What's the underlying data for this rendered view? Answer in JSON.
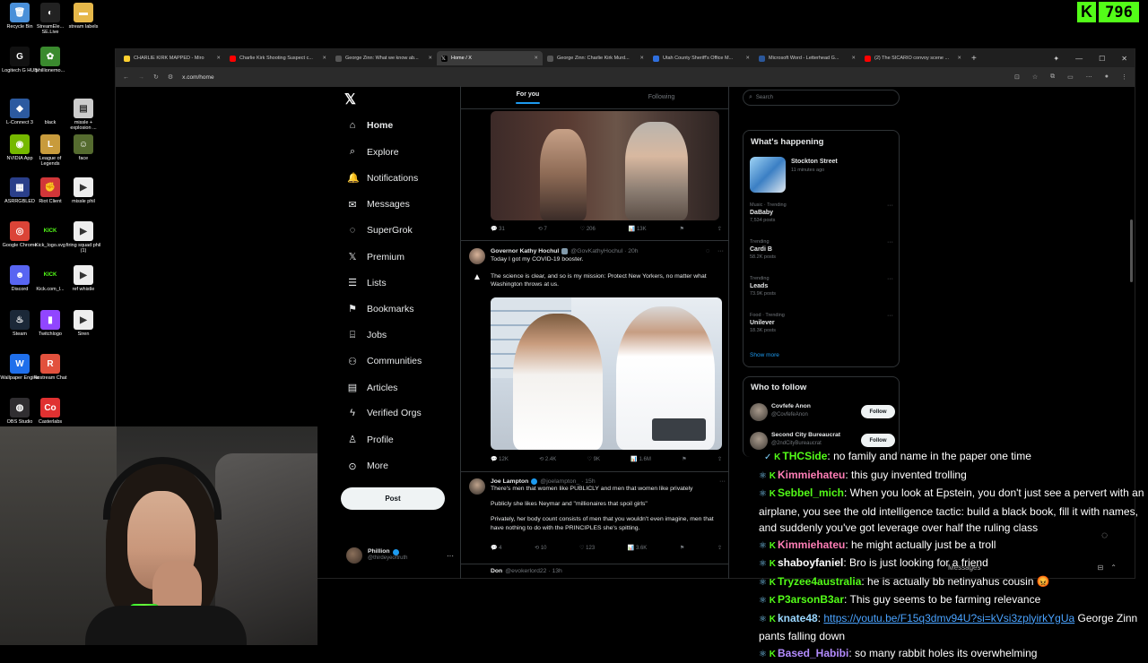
{
  "desktop": {
    "icons": [
      {
        "label": "Recycle Bin",
        "color": "#4a90d9",
        "glyph": "🗑"
      },
      {
        "label": "StreamEle... SE.Live",
        "color": "#222222",
        "glyph": "◐"
      },
      {
        "label": "stream labels",
        "color": "#e6b84a",
        "glyph": "▬"
      },
      {
        "label": "Logitech G HUB",
        "color": "#111111",
        "glyph": "G"
      },
      {
        "label": "phillionemo...",
        "color": "#3a8a2e",
        "glyph": "✿"
      },
      {
        "label": "L-Connect 3",
        "color": "#2c5aa0",
        "glyph": "◆"
      },
      {
        "label": "black",
        "color": "#000000",
        "glyph": ""
      },
      {
        "label": "missle + explosion ...",
        "color": "#cccccc",
        "glyph": "▤"
      },
      {
        "label": "NVIDIA App",
        "color": "#76b900",
        "glyph": "◉"
      },
      {
        "label": "League of Legends",
        "color": "#c89b3c",
        "glyph": "L"
      },
      {
        "label": "face",
        "color": "#556b2f",
        "glyph": "☺"
      },
      {
        "label": "ASRRGBLED",
        "color": "#2a3f8a",
        "glyph": "▦"
      },
      {
        "label": "Riot Client",
        "color": "#d13639",
        "glyph": "✊"
      },
      {
        "label": "missle phil",
        "color": "#eeeeee",
        "glyph": "▶"
      },
      {
        "label": "Google Chrome",
        "color": "#db4437",
        "glyph": "◎"
      },
      {
        "label": "Kick_logo.svg",
        "color": "#000000",
        "glyph": "KICK"
      },
      {
        "label": "firing squad phil (1)",
        "color": "#eeeeee",
        "glyph": "▶"
      },
      {
        "label": "Discord",
        "color": "#5865f2",
        "glyph": "☻"
      },
      {
        "label": "Kick.com_l...",
        "color": "#000000",
        "glyph": "KICK"
      },
      {
        "label": "ref whistle",
        "color": "#eeeeee",
        "glyph": "▶"
      },
      {
        "label": "Steam",
        "color": "#1b2838",
        "glyph": "♨"
      },
      {
        "label": "Twitchlogo",
        "color": "#9146ff",
        "glyph": "▮"
      },
      {
        "label": "Siren",
        "color": "#eeeeee",
        "glyph": "▶"
      },
      {
        "label": "Wallpaper Engine",
        "color": "#1f6feb",
        "glyph": "W"
      },
      {
        "label": "Restream Chat",
        "color": "#e2513d",
        "glyph": "R"
      },
      {
        "label": "OBS Studio",
        "color": "#302e31",
        "glyph": "◍"
      },
      {
        "label": "Casterlabs",
        "color": "#e03131",
        "glyph": "Co"
      }
    ]
  },
  "kick_counter": {
    "logo": "K",
    "count": "796",
    "color": "#53fc18"
  },
  "browser": {
    "tabs": [
      {
        "title": "CHARLIE KIRK MAPPED - Miro",
        "color": "#ffd02f"
      },
      {
        "title": "Charlie Kirk Shooting Suspect c...",
        "color": "#ff0000"
      },
      {
        "title": "George Zinn: What we know ab...",
        "color": "#555555"
      },
      {
        "title": "Home / X",
        "color": "#000000"
      },
      {
        "title": "George Zinn: Charlie Kirk Murd...",
        "color": "#555555"
      },
      {
        "title": "Utah County Sheriff's Office M...",
        "color": "#2f6fde"
      },
      {
        "title": "Microsoft Word - Letterhead G...",
        "color": "#2b579a"
      },
      {
        "title": "(2) The SICARIO convoy scene ...",
        "color": "#ff0000"
      }
    ],
    "url": "x.com/home"
  },
  "x": {
    "logo": "𝕏",
    "nav": [
      {
        "label": "Home",
        "icon": "home-icon",
        "glyph": "⌂"
      },
      {
        "label": "Explore",
        "icon": "search-icon",
        "glyph": "⌕"
      },
      {
        "label": "Notifications",
        "icon": "bell-icon",
        "glyph": "🔔"
      },
      {
        "label": "Messages",
        "icon": "envelope-icon",
        "glyph": "✉"
      },
      {
        "label": "SuperGrok",
        "icon": "grok-icon",
        "glyph": "◌"
      },
      {
        "label": "Premium",
        "icon": "x-premium-icon",
        "glyph": "𝕏"
      },
      {
        "label": "Lists",
        "icon": "list-icon",
        "glyph": "☰"
      },
      {
        "label": "Bookmarks",
        "icon": "bookmark-icon",
        "glyph": "⚑"
      },
      {
        "label": "Jobs",
        "icon": "briefcase-icon",
        "glyph": "⌸"
      },
      {
        "label": "Communities",
        "icon": "people-icon",
        "glyph": "⚇"
      },
      {
        "label": "Articles",
        "icon": "article-icon",
        "glyph": "▤"
      },
      {
        "label": "Verified Orgs",
        "icon": "lightning-icon",
        "glyph": "ϟ"
      },
      {
        "label": "Profile",
        "icon": "person-icon",
        "glyph": "♙"
      },
      {
        "label": "More",
        "icon": "more-circle-icon",
        "glyph": "⊙"
      }
    ],
    "post_label": "Post",
    "account": {
      "name": "Phillion",
      "handle": "@thirdeyeoftruth"
    },
    "feed_tabs": {
      "for_you": "For you",
      "following": "Following"
    },
    "tweet1_actions": {
      "replies": "31",
      "reposts": "7",
      "likes": "206",
      "views": "13K"
    },
    "tweet2": {
      "name": "Governor Kathy Hochul",
      "handle": "@GovKathyHochul · 20h",
      "line1": "Today I got my COVID-19 booster.",
      "line2": "The science is clear, and so is my mission: Protect New Yorkers, no matter what Washington throws at us.",
      "actions": {
        "replies": "12K",
        "reposts": "2.4K",
        "likes": "9K",
        "views": "1.6M"
      }
    },
    "tweet3": {
      "name": "Joe Lampton",
      "handle": "@joelampton_ · 15h",
      "line1": "There's men that women like PUBLICLY and men that women like privately",
      "line2": "Publicly she likes Neymar and \"millionaires that spoil girls\"",
      "line3": "Privately, her body count consists of men that you wouldn't even imagine, men that have nothing to do with the PRINCIPLES she's spitting.",
      "actions": {
        "replies": "4",
        "reposts": "10",
        "likes": "123",
        "views": "3.6K"
      }
    },
    "tweet4": {
      "name": "Don",
      "handle": "@evokerlord22 · 13h"
    },
    "search_placeholder": "Search",
    "whats_happening": {
      "title": "What's happening",
      "event": {
        "title": "Stockton Street",
        "time": "11 minutes ago"
      },
      "trends": [
        {
          "context": "Music · Trending",
          "name": "DaBaby",
          "posts": "7,534 posts"
        },
        {
          "context": "Trending",
          "name": "Cardi B",
          "posts": "58.2K posts"
        },
        {
          "context": "Trending",
          "name": "Leads",
          "posts": "73.9K posts"
        },
        {
          "context": "Food · Trending",
          "name": "Unilever",
          "posts": "18.3K posts"
        }
      ],
      "show_more": "Show more"
    },
    "who_to_follow": {
      "title": "Who to follow",
      "accounts": [
        {
          "name": "Covfefe Anon",
          "handle": "@CovfefeAnon",
          "button": "Follow"
        },
        {
          "name": "Second City Bureaucrat",
          "handle": "@2ndCityBureaucrat",
          "button": "Follow"
        }
      ]
    },
    "messages_label": "Messages"
  },
  "chat": [
    {
      "user": "THCSide",
      "color": "#53fc18",
      "msg": ": no family and name in the paper one time"
    },
    {
      "user": "Kimmiehateu",
      "color": "#ff7eb6",
      "msg": ": this guy invented trolling"
    },
    {
      "user": "Sebbel_mich",
      "color": "#53fc18",
      "msg": ": When you look at Epstein, you don't just see a pervert with an airplane, you see the old intelligence tactic: build a black book, fill it with names, and suddenly you've got leverage over half the ruling class"
    },
    {
      "user": "Kimmiehateu",
      "color": "#ff7eb6",
      "msg": ": he might actually just be a troll"
    },
    {
      "user": "shaboyfaniel",
      "color": "#ffffff",
      "msg": ": Bro is just looking for a friend"
    },
    {
      "user": "Tryzee4australia",
      "color": "#53fc18",
      "msg": ": he is actually bb netinyahus cousin 😡"
    },
    {
      "user": "P3arsonB3ar",
      "color": "#53fc18",
      "msg": ": This guy seems to be farming relevance"
    },
    {
      "user": "knate48",
      "color": "#9ad7ff",
      "msg": ": ",
      "link": "https://youtu.be/F15q3dmv94U?si=kVsi3zplyirkYgUa",
      "after": " George Zinn pants falling down"
    },
    {
      "user": "Based_Habibi",
      "color": "#b48cff",
      "msg": ": so many rabbit holes its overwhelming"
    }
  ]
}
